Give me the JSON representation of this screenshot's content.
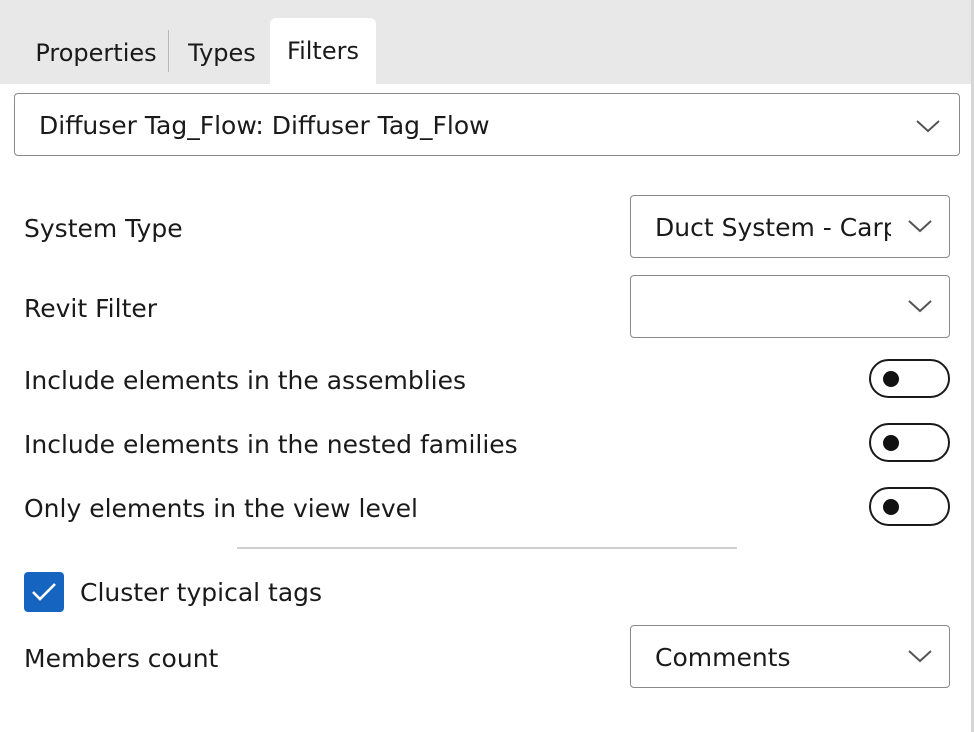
{
  "tabs": {
    "properties": "Properties",
    "types": "Types",
    "filters": "Filters",
    "active": "Filters"
  },
  "tag_selector": {
    "value": "Diffuser Tag_Flow: Diffuser Tag_Flow"
  },
  "system_type": {
    "label": "System Type",
    "value": "Duct System - Carp"
  },
  "revit_filter": {
    "label": "Revit Filter",
    "value": ""
  },
  "toggles": {
    "assemblies": {
      "label": "Include elements in the assemblies",
      "on": false
    },
    "nested_families": {
      "label": "Include elements in the nested families",
      "on": false
    },
    "view_level": {
      "label": "Only elements in the view level",
      "on": false
    }
  },
  "cluster": {
    "label": "Cluster typical tags",
    "checked": true
  },
  "members_count": {
    "label": "Members count",
    "value": "Comments"
  },
  "colors": {
    "accent": "#1565c0",
    "tabbar_bg": "#e8e8e8",
    "border": "#8a8a8a"
  },
  "icons": {
    "dropdown": "chevron-down-icon",
    "check": "checkmark-icon"
  }
}
